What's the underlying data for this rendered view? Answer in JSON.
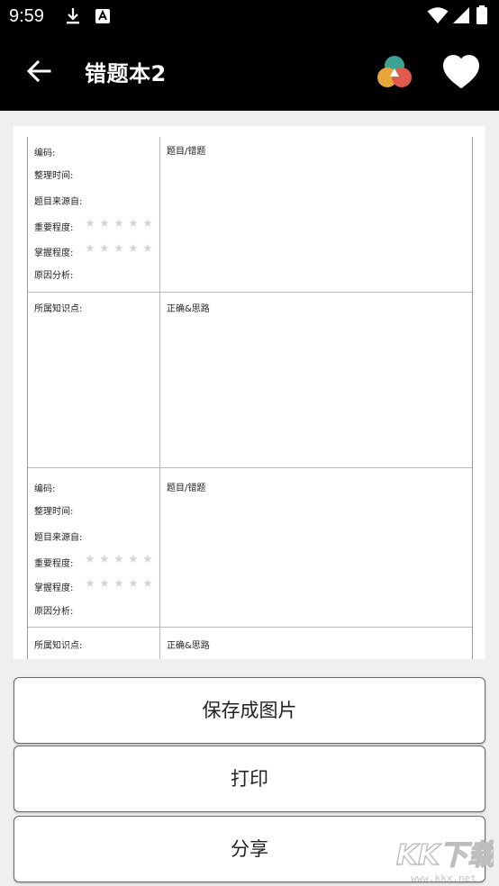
{
  "status_bar": {
    "time": "9:59",
    "icons": [
      "download-icon",
      "keyboard-a-icon",
      "wifi-icon",
      "signal-icon",
      "battery-icon"
    ]
  },
  "app_bar": {
    "title": "错题本2",
    "icons": [
      "back-arrow-icon",
      "color-circles-icon",
      "heart-icon"
    ]
  },
  "sheet": {
    "blocks": [
      {
        "fields": {
          "code": "编码:",
          "time": "整理时间:",
          "source": "题目来源自:",
          "importance": "重要程度:",
          "mastery": "掌握程度:",
          "reason": "原因分析:"
        },
        "question_title": "题目/错题",
        "knowledge": "所属知识点:",
        "answer_title": "正确&思路"
      },
      {
        "fields": {
          "code": "编码:",
          "time": "整理时间:",
          "source": "题目来源自:",
          "importance": "重要程度:",
          "mastery": "掌握程度:",
          "reason": "原因分析:"
        },
        "question_title": "题目/错题",
        "knowledge": "所属知识点:",
        "answer_title": "正确&思路"
      }
    ],
    "rating": {
      "importance": 0,
      "mastery": 0,
      "max": 5,
      "star": "★"
    }
  },
  "actions": {
    "save_image": "保存成图片",
    "print": "打印",
    "share": "分享"
  },
  "watermark": {
    "text": "KK下载",
    "url": "www.kkx.net"
  },
  "colors": {
    "bar": "#000000",
    "accent_teal": "#3aa394",
    "accent_orange": "#e7a53a",
    "accent_red": "#e05a4e"
  }
}
